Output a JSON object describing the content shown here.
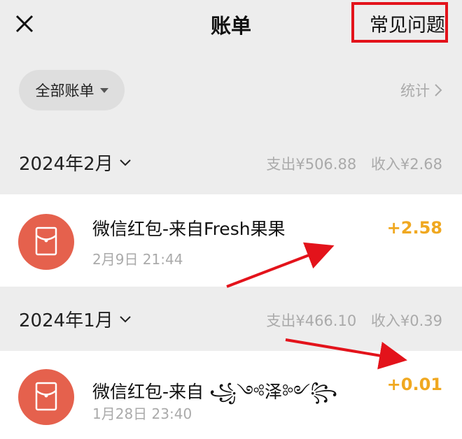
{
  "header": {
    "title": "账单",
    "faq_label": "常见问题"
  },
  "filter": {
    "label": "全部账单",
    "stats_label": "统计"
  },
  "months": [
    {
      "label": "2024年2月",
      "out": "支出¥506.88",
      "in": "收入¥2.68"
    },
    {
      "label": "2024年1月",
      "out": "支出¥466.10",
      "in": "收入¥0.39"
    }
  ],
  "entries": [
    {
      "title": "微信红包-来自Fresh果果",
      "time": "2月9日 21:44",
      "amount": "+2.58"
    },
    {
      "title": "微信红包-来自 ꧁༺泽༻꧂",
      "time": "1月28日 23:40",
      "amount": "+0.01"
    }
  ],
  "colors": {
    "background": "#ededed",
    "amount": "#f0a820",
    "avatar": "#e5614d",
    "highlight_box": "#e3131b"
  }
}
